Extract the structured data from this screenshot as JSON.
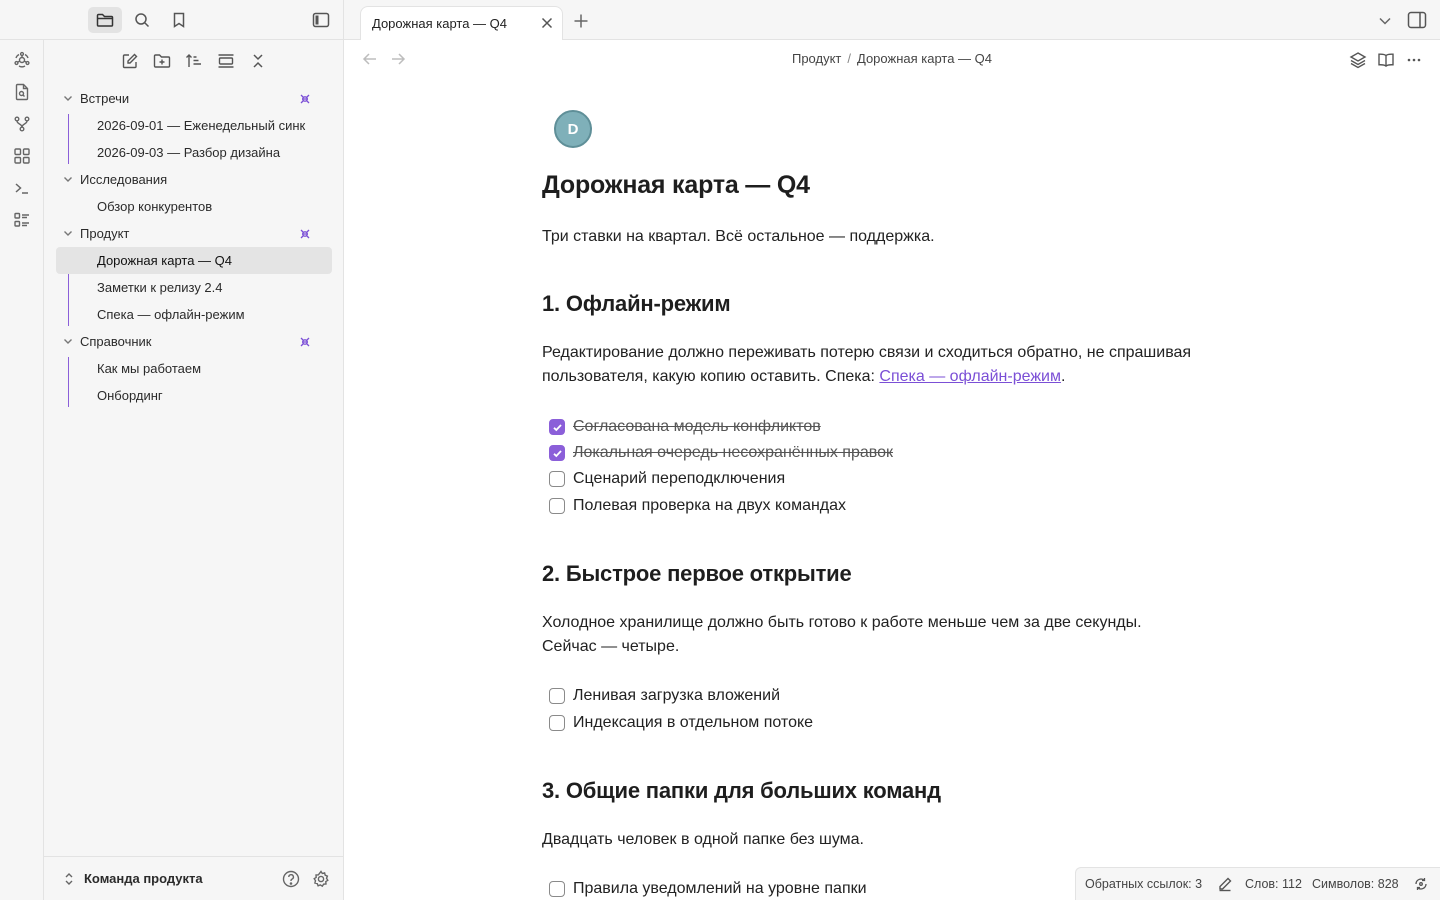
{
  "sidebar_top": {
    "tabs": [
      "files",
      "search",
      "bookmarks"
    ],
    "toggle": "sidebar-toggle"
  },
  "ribbon": [
    "graph-icon",
    "file-search-icon",
    "git-branch-icon",
    "blocks-icon",
    "terminal-icon",
    "list-checks-icon"
  ],
  "tree": {
    "folders": [
      {
        "name": "Встречи",
        "files": [
          "2026-09-01 — Еженедельный синк",
          "2026-09-03 — Разбор дизайна"
        ]
      },
      {
        "name": "Исследования",
        "files": [
          "Обзор конкурентов"
        ]
      },
      {
        "name": "Продукт",
        "files": [
          "Дорожная карта — Q4",
          "Заметки к релизу 2.4",
          "Спека — офлайн-режим"
        ]
      },
      {
        "name": "Справочник",
        "files": [
          "Как мы работаем",
          "Онбординг"
        ]
      }
    ],
    "active_file": "Дорожная карта — Q4"
  },
  "vault": {
    "name": "Команда продукта"
  },
  "tab": {
    "title": "Дорожная карта — Q4"
  },
  "breadcrumb": {
    "folder": "Продукт",
    "separator": "/",
    "file": "Дорожная карта — Q4"
  },
  "note": {
    "avatar_letter": "D",
    "title": "Дорожная карта — Q4",
    "intro": "Три ставки на квартал. Всё остальное — поддержка.",
    "s1": {
      "heading": "1. Офлайн-режим",
      "text_line1": "Редактирование должно переживать потерю связи и сходиться обратно, не спрашивая",
      "text_line2_prefix": "пользователя, какую копию оставить. Спека: ",
      "link": "Спека — офлайн-режим",
      "text_line2_suffix": ".",
      "tasks": [
        {
          "text": "Согласована модель конфликтов",
          "done": true
        },
        {
          "text": "Локальная очередь несохранённых правок",
          "done": true
        },
        {
          "text": "Сценарий переподключения",
          "done": false
        },
        {
          "text": "Полевая проверка на двух командах",
          "done": false
        }
      ]
    },
    "s2": {
      "heading": "2. Быстрое первое открытие",
      "text_line1": "Холодное хранилище должно быть готово к работе меньше чем за две секунды.",
      "text_line2": "Сейчас — четыре.",
      "tasks": [
        {
          "text": "Ленивая загрузка вложений",
          "done": false
        },
        {
          "text": "Индексация в отдельном потоке",
          "done": false
        }
      ]
    },
    "s3": {
      "heading": "3. Общие папки для больших команд",
      "text": "Двадцать человек в одной папке без шума.",
      "tasks": [
        {
          "text": "Правила уведомлений на уровне папки",
          "done": false
        }
      ]
    }
  },
  "status": {
    "backlinks": "Обратных ссылок: 3",
    "words": "Слов: 112",
    "chars": "Символов: 828"
  },
  "colors": {
    "accent": "#8b5fd9",
    "link": "#7b4fd6",
    "avatar": "#7fb0b9"
  }
}
